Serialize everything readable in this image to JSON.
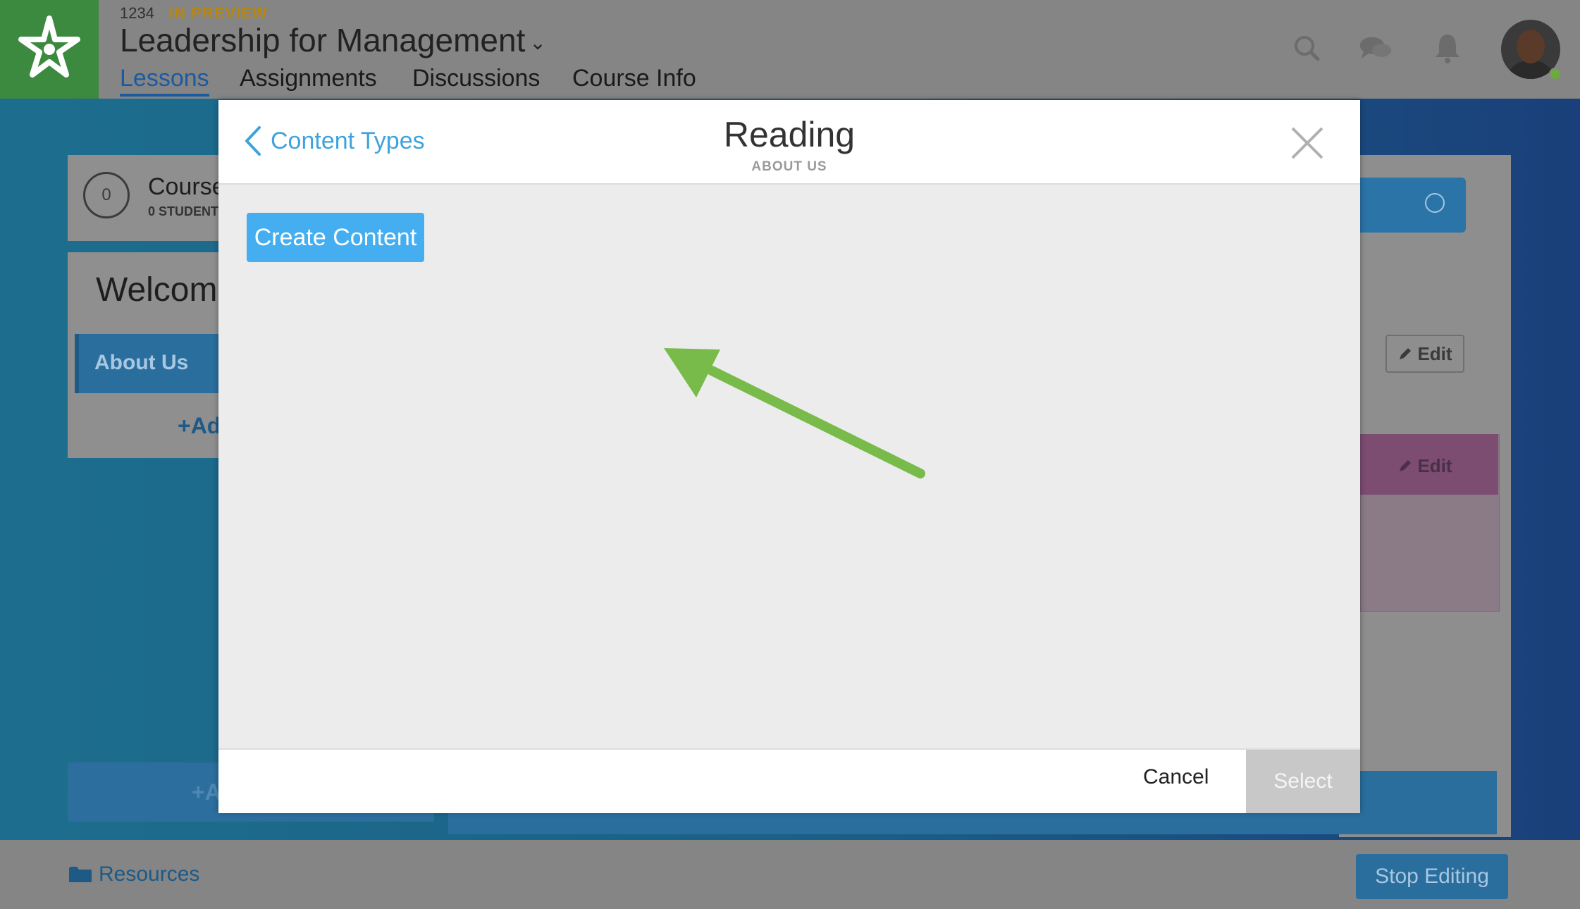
{
  "header": {
    "course_code": "1234",
    "preview_label": "IN PREVIEW",
    "course_title": "Leadership for Management",
    "title_chevron": "⌄",
    "tabs": [
      {
        "label": "Lessons",
        "active": true
      },
      {
        "label": "Assignments",
        "active": false
      },
      {
        "label": "Discussions",
        "active": false
      },
      {
        "label": "Course Info",
        "active": false
      }
    ],
    "icons": [
      "search-icon",
      "chat-icon",
      "bell-icon"
    ],
    "brand_color": "#3b8a3f"
  },
  "sidebar": {
    "progress_value": "0",
    "course_label": "Course",
    "students_label": "0 STUDENT",
    "welcome_title": "Welcome!",
    "items": [
      {
        "label": "About Us"
      }
    ],
    "add_label": "+Ad",
    "add_bottom_label": "+A"
  },
  "content": {
    "edit_label": "Edit"
  },
  "footer": {
    "resources_label": "Resources",
    "stop_editing_label": "Stop Editing"
  },
  "modal": {
    "back_label": "Content Types",
    "title": "Reading",
    "subtitle": "ABOUT US",
    "create_button": "Create Content",
    "cancel_label": "Cancel",
    "select_label": "Select",
    "accent_color": "#44aef0",
    "annotation_arrow_color": "#78bb4a"
  }
}
